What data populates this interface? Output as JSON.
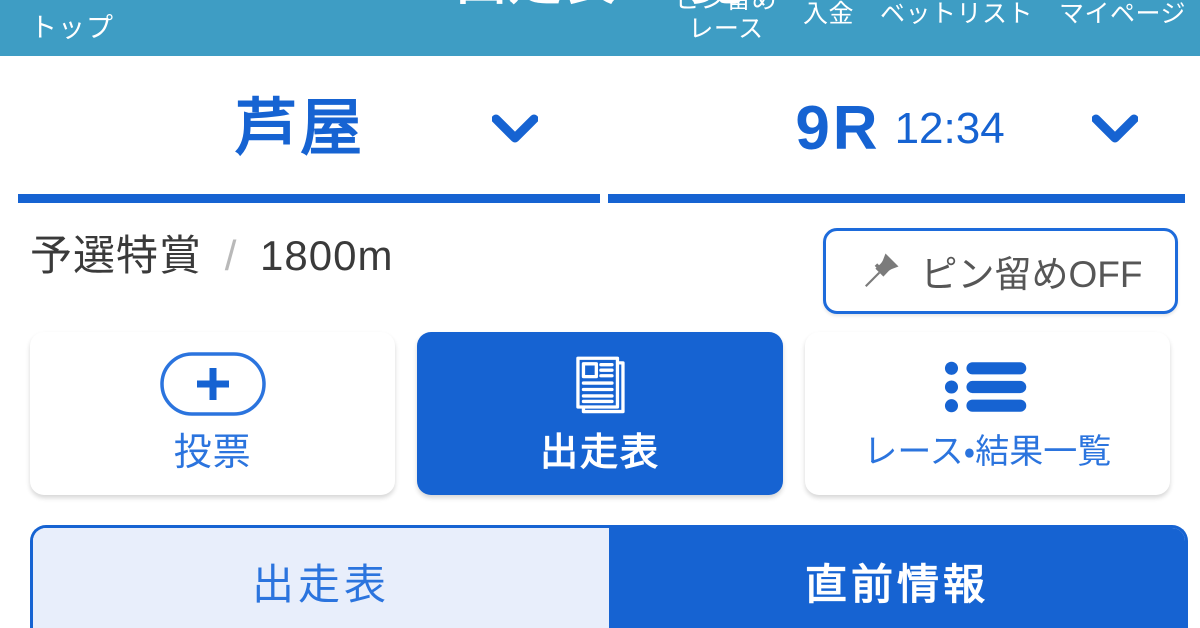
{
  "colors": {
    "header_bg": "#3e9dc4",
    "accent_blue": "#1663d2",
    "link_blue": "#2b74de",
    "tab_inactive_bg": "#e8eefb",
    "text_dark": "#3a3a3a",
    "text_gray": "#565656"
  },
  "global_header": {
    "title": "出走表・一覧",
    "nav_left": {
      "label": "トップ",
      "icon": "home-icon"
    },
    "nav_right": [
      {
        "label_line1": "ピン留め",
        "label_line2": "レース",
        "icon": "pin-icon"
      },
      {
        "label": "入金",
        "icon": "wallet-icon"
      },
      {
        "label": "ベットリスト",
        "icon": "list-icon"
      },
      {
        "label": "マイページ",
        "icon": "person-icon"
      }
    ]
  },
  "selectors": {
    "venue": {
      "label": "芦屋",
      "chevron_icon": "chevron-down-icon"
    },
    "race": {
      "number": "9R",
      "time": "12:34",
      "chevron_icon": "chevron-down-icon"
    }
  },
  "race_info": {
    "grade": "予選特賞",
    "separator": "/",
    "distance": "1800m"
  },
  "pin_button": {
    "label": "ピン留めOFF",
    "icon": "pushpin-icon",
    "state": "OFF"
  },
  "actions": [
    {
      "label": "投票",
      "icon": "plus-in-pill-icon",
      "active": false
    },
    {
      "label": "出走表",
      "icon": "race-card-document-icon",
      "active": true
    },
    {
      "label": "レース・結果一覧",
      "icon": "bulleted-list-icon",
      "active": false
    }
  ],
  "tabs": [
    {
      "label": "出走表",
      "active": false
    },
    {
      "label": "直前情報",
      "active": true
    }
  ]
}
